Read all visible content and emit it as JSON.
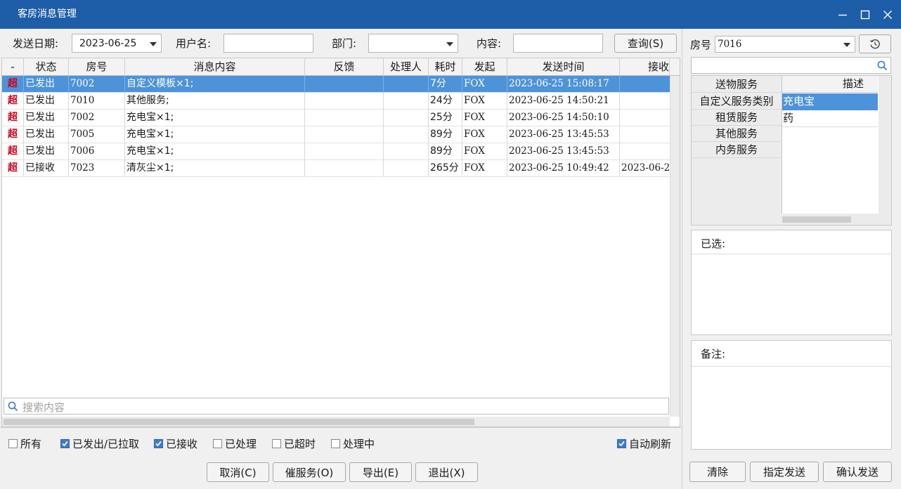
{
  "window": {
    "title": "客房消息管理"
  },
  "filters": {
    "date_label": "发送日期:",
    "date_value": "2023-06-25",
    "user_label": "用户名:",
    "user_value": "",
    "dept_label": "部门:",
    "dept_value": "",
    "content_label": "内容:",
    "content_value": "",
    "query_button": "查询(S)"
  },
  "grid": {
    "columns": [
      "-",
      "状态",
      "房号",
      "消息内容",
      "反馈",
      "处理人",
      "耗时",
      "发起",
      "发送时间",
      "接收"
    ],
    "rows": [
      {
        "flag": "超",
        "status": "已发出",
        "room": "7002",
        "content": "自定义模板×1;",
        "feedback": "",
        "handler": "",
        "duration": "7分",
        "initiator": "FOX",
        "send_time": "2023-06-25 15:08:17",
        "recv_time": ""
      },
      {
        "flag": "超",
        "status": "已发出",
        "room": "7010",
        "content": "其他服务;",
        "feedback": "",
        "handler": "",
        "duration": "24分",
        "initiator": "FOX",
        "send_time": "2023-06-25 14:50:21",
        "recv_time": ""
      },
      {
        "flag": "超",
        "status": "已发出",
        "room": "7002",
        "content": "充电宝×1;",
        "feedback": "",
        "handler": "",
        "duration": "25分",
        "initiator": "FOX",
        "send_time": "2023-06-25 14:50:10",
        "recv_time": ""
      },
      {
        "flag": "超",
        "status": "已发出",
        "room": "7005",
        "content": "充电宝×1;",
        "feedback": "",
        "handler": "",
        "duration": "89分",
        "initiator": "FOX",
        "send_time": "2023-06-25 13:45:53",
        "recv_time": ""
      },
      {
        "flag": "超",
        "status": "已发出",
        "room": "7006",
        "content": "充电宝×1;",
        "feedback": "",
        "handler": "",
        "duration": "89分",
        "initiator": "FOX",
        "send_time": "2023-06-25 13:45:53",
        "recv_time": ""
      },
      {
        "flag": "超",
        "status": "已接收",
        "room": "7023",
        "content": "清灰尘×1;",
        "feedback": "",
        "handler": "",
        "duration": "265分",
        "initiator": "FOX",
        "send_time": "2023-06-25 10:49:42",
        "recv_time": "2023-06-2"
      }
    ],
    "search_placeholder": "搜索内容"
  },
  "checkboxes": [
    {
      "label": "所有",
      "checked": false
    },
    {
      "label": "已发出/已拉取",
      "checked": true
    },
    {
      "label": "已接收",
      "checked": true
    },
    {
      "label": "已处理",
      "checked": false
    },
    {
      "label": "已超时",
      "checked": false
    },
    {
      "label": "处理中",
      "checked": false
    }
  ],
  "auto_refresh": {
    "label": "自动刷新",
    "checked": true
  },
  "bottom_buttons": {
    "cancel": "取消(C)",
    "urge": "催服务(O)",
    "export": "导出(E)",
    "exit": "退出(X)"
  },
  "right": {
    "room_label": "房号",
    "room_value": "7016",
    "categories": [
      "送物服务",
      "自定义服务类别",
      "租赁服务",
      "其他服务",
      "内务服务"
    ],
    "desc_header": "描述",
    "items": [
      "充电宝",
      "药"
    ],
    "selected_label": "已选:",
    "remark_label": "备注:",
    "buttons": {
      "clear": "清除",
      "assign_send": "指定发送",
      "confirm_send": "确认发送"
    }
  },
  "colors": {
    "titlebar": "#1e5da8",
    "selected_row": "#4d93d9",
    "overtime_flag": "#d0021b",
    "checkbox_on": "#3b7bd4"
  }
}
